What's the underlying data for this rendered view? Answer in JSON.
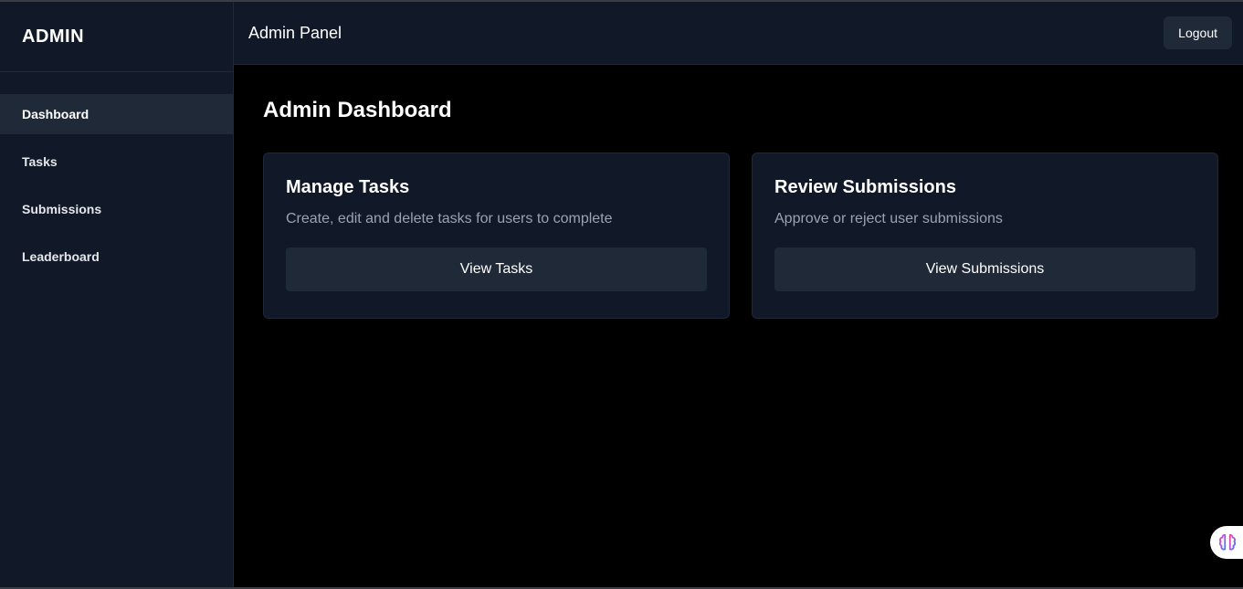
{
  "sidebar": {
    "brand": "ADMIN",
    "items": [
      {
        "label": "Dashboard",
        "active": true
      },
      {
        "label": "Tasks"
      },
      {
        "label": "Submissions"
      },
      {
        "label": "Leaderboard"
      }
    ]
  },
  "topbar": {
    "title": "Admin Panel",
    "logout_label": "Logout"
  },
  "main": {
    "title": "Admin Dashboard",
    "cards": [
      {
        "title": "Manage Tasks",
        "description": "Create, edit and delete tasks for users to complete",
        "button": "View Tasks"
      },
      {
        "title": "Review Submissions",
        "description": "Approve or reject user submissions",
        "button": "View Submissions"
      }
    ]
  },
  "widget": {
    "icon": "brain-icon"
  },
  "colors": {
    "background": "#000000",
    "panel": "#111827",
    "active": "#1f2937",
    "muted_text": "#9ca3af"
  }
}
